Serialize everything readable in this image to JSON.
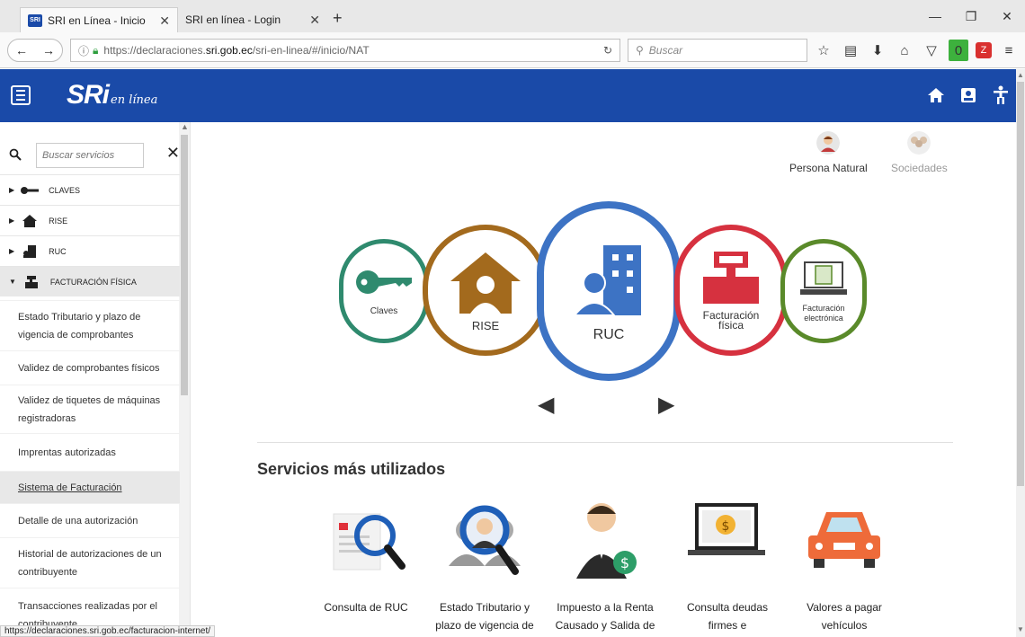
{
  "browser": {
    "tabs": [
      {
        "favicon": "SRI",
        "title": "SRI en Línea - Inicio"
      },
      {
        "title": "SRI en línea - Login"
      }
    ],
    "tab_close": "✕",
    "new_tab": "+",
    "window": {
      "minimize": "—",
      "restore": "❐",
      "close": "✕"
    },
    "url_prefix": "https://declaraciones.",
    "url_host": "sri.gob.ec",
    "url_path": "/sri-en-linea/#/inicio/NAT",
    "search_placeholder": "Buscar",
    "addon_badge": "0",
    "status_url": "https://declaraciones.sri.gob.ec/facturacion-internet/"
  },
  "header": {
    "logo_main": "SRi",
    "logo_sub": "en línea"
  },
  "sidebar": {
    "search_placeholder": "Buscar servicios",
    "close": "✕",
    "categories": [
      {
        "label": "CLAVES"
      },
      {
        "label": "RISE"
      },
      {
        "label": "RUC"
      },
      {
        "label": "FACTURACIÓN FÍSICA"
      }
    ],
    "subitems": [
      "Estado Tributario y plazo de vigencia de comprobantes",
      "Validez de comprobantes físicos",
      "Validez de tiquetes de máquinas registradoras",
      "Imprentas autorizadas",
      "Sistema de Facturación",
      "Detalle de una autorización",
      "Historial de autorizaciones de un contribuyente",
      "Transacciones realizadas por el contribuyente"
    ]
  },
  "user_types": {
    "natural": "Persona Natural",
    "sociedades": "Sociedades"
  },
  "carousel": {
    "claves": "Claves",
    "rise": "RISE",
    "ruc": "RUC",
    "fisica_l1": "Facturación",
    "fisica_l2": "física",
    "electronica_l1": "Facturación",
    "electronica_l2": "electrónica",
    "prev": "◀",
    "next": "▶"
  },
  "services": {
    "title": "Servicios más utilizados",
    "items": [
      {
        "l1": "Consulta de RUC",
        "l2": ""
      },
      {
        "l1": "Estado Tributario y",
        "l2": "plazo de vigencia de"
      },
      {
        "l1": "Impuesto a la Renta",
        "l2": "Causado y Salida de"
      },
      {
        "l1": "Consulta deudas",
        "l2": "firmes e"
      },
      {
        "l1": "Valores a pagar",
        "l2": "vehículos"
      }
    ]
  },
  "colors": {
    "brand_blue": "#1a4aa8",
    "claves_green": "#2f8a6e",
    "rise_brown": "#a36a1d",
    "ruc_blue": "#3d73c4",
    "fisica_red": "#d6313f",
    "electronica_green": "#5a8a2a"
  }
}
